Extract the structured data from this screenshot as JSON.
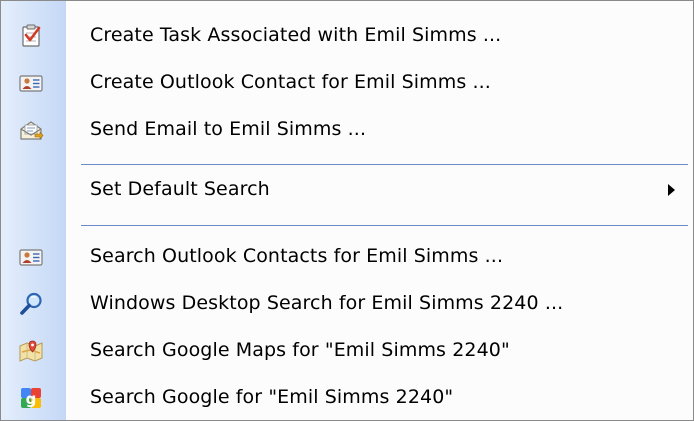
{
  "menu": {
    "items": [
      {
        "label": "Create Task Associated with Emil Simms ...",
        "icon": "task-icon"
      },
      {
        "label": "Create Outlook Contact for Emil Simms ...",
        "icon": "contact-card-icon"
      },
      {
        "label": "Send Email to Emil Simms ...",
        "icon": "send-email-icon"
      },
      {
        "label": "Set Default Search",
        "icon": "none",
        "has_submenu": true
      },
      {
        "label": "Search Outlook Contacts for Emil Simms ...",
        "icon": "contact-card-icon"
      },
      {
        "label": "Windows Desktop Search for Emil Simms 2240 ...",
        "icon": "magnifier-icon"
      },
      {
        "label": "Search Google Maps for \"Emil Simms 2240\"",
        "icon": "google-maps-icon"
      },
      {
        "label": "Search Google for \"Emil Simms 2240\"",
        "icon": "google-icon"
      }
    ]
  },
  "colors": {
    "gutter": "#c4d8f6",
    "separator": "#6b8ac6",
    "background": "#fcfcfc"
  }
}
